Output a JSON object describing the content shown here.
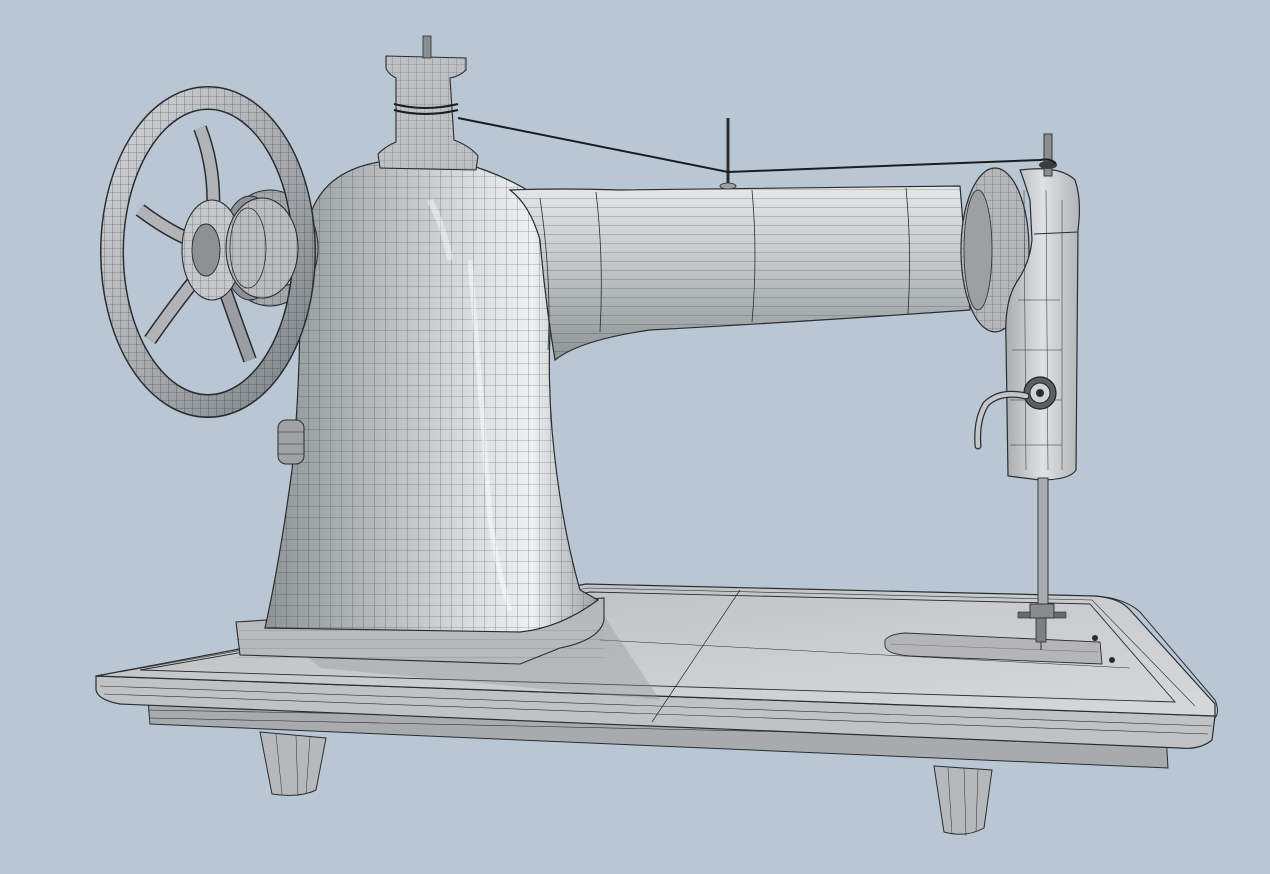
{
  "scene": {
    "subject": "sewing-machine-wireframe-render",
    "colors": {
      "background": "#b9c6d3",
      "surface": "#c9ccce",
      "surface_light": "#d9dbdc",
      "surface_dark": "#8f9497",
      "wire": "#2a2d30",
      "thread": "#1b1c1d"
    }
  }
}
